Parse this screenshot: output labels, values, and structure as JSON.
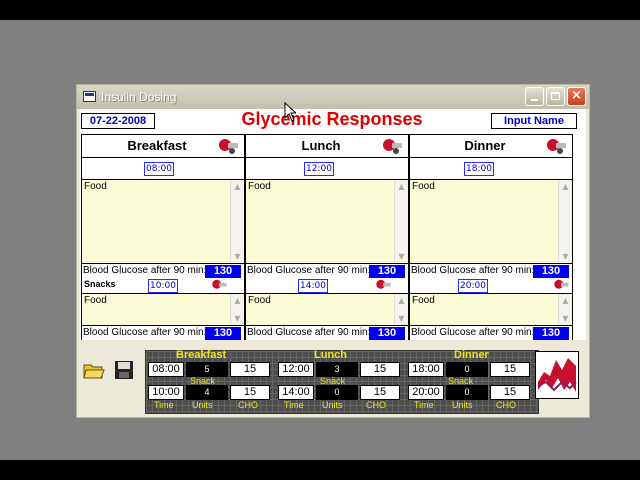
{
  "window": {
    "title": "Insulin Dosing"
  },
  "header": {
    "date": "07-22-2008",
    "title": "Glycemic Responses",
    "input_name": "Input Name"
  },
  "meals": [
    {
      "name": "Breakfast",
      "time": "08:00",
      "food_label": "Food",
      "bg_label": "Blood Glucose after 90 min:",
      "bg_value": "130"
    },
    {
      "name": "Lunch",
      "time": "12:00",
      "food_label": "Food",
      "bg_label": "Blood Glucose after 90 min:",
      "bg_value": "130"
    },
    {
      "name": "Dinner",
      "time": "18:00",
      "food_label": "Food",
      "bg_label": "Blood Glucose after 90 min:",
      "bg_value": "130"
    }
  ],
  "snacks": {
    "label": "Snacks",
    "items": [
      {
        "time": "10:00",
        "food_label": "Food",
        "bg_label": "Blood Glucose after 90 min:",
        "bg_value": "130"
      },
      {
        "time": "14:00",
        "food_label": "Food",
        "bg_label": "Blood Glucose after 90 min:",
        "bg_value": "130"
      },
      {
        "time": "20:00",
        "food_label": "Food",
        "bg_label": "Blood Glucose after 90 min:",
        "bg_value": "130"
      }
    ]
  },
  "summary": {
    "meal_labels": [
      "Breakfast",
      "Lunch",
      "Dinner"
    ],
    "snack_label": "Snack",
    "col_labels": [
      "Time",
      "Units",
      "CHO"
    ],
    "meal_rows": [
      {
        "time": "08:00",
        "units": "5",
        "cho": "15"
      },
      {
        "time": "12:00",
        "units": "3",
        "cho": "15"
      },
      {
        "time": "18:00",
        "units": "0",
        "cho": "15"
      }
    ],
    "snack_rows": [
      {
        "time": "10:00",
        "units": "4",
        "cho": "15"
      },
      {
        "time": "14:00",
        "units": "0",
        "cho": "15"
      },
      {
        "time": "20:00",
        "units": "0",
        "cho": "15"
      }
    ]
  },
  "colors": {
    "title_red": "#e00000",
    "value_blue": "#0000ee",
    "food_bg": "#fbfbd6",
    "grid_label": "#f2e31c"
  }
}
